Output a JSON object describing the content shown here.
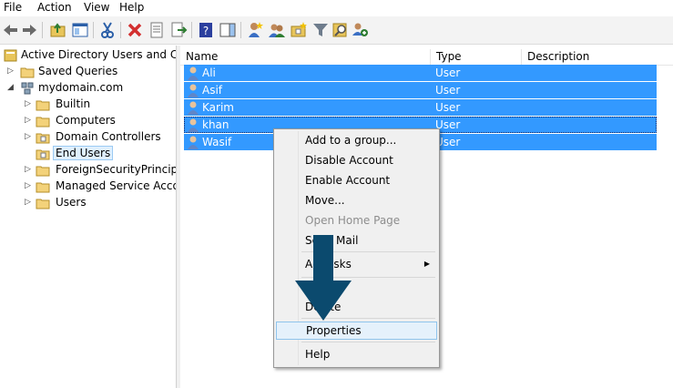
{
  "menubar": {
    "file": "File",
    "action": "Action",
    "view": "View",
    "help": "Help"
  },
  "toolbar": {
    "icons": [
      "back-arrow-icon",
      "forward-arrow-icon",
      "up-folder-icon",
      "show-hide-tree-icon",
      "cut-icon",
      "delete-icon",
      "properties-icon",
      "export-list-icon",
      "help-icon",
      "show-action-pane-icon",
      "new-user-icon",
      "new-group-icon",
      "new-ou-icon",
      "filter-icon",
      "find-icon",
      "add-to-group-icon"
    ]
  },
  "tree": {
    "root": "Active Directory Users and Com",
    "saved_queries": "Saved Queries",
    "domain": "mydomain.com",
    "children": [
      "Builtin",
      "Computers",
      "Domain Controllers",
      "End Users",
      "ForeignSecurityPrincipals",
      "Managed Service Accounts",
      "Users"
    ],
    "selected": "End Users"
  },
  "list": {
    "columns": {
      "name": "Name",
      "type": "Type",
      "description": "Description"
    },
    "rows": [
      {
        "name": "Ali",
        "type": "User"
      },
      {
        "name": "Asif",
        "type": "User"
      },
      {
        "name": "Karim",
        "type": "User"
      },
      {
        "name": "khan",
        "type": "User"
      },
      {
        "name": "Wasif",
        "type": "User"
      }
    ]
  },
  "context_menu": {
    "items": [
      {
        "label": "Add to a group...",
        "enabled": true
      },
      {
        "label": "Disable Account",
        "enabled": true
      },
      {
        "label": "Enable Account",
        "enabled": true
      },
      {
        "label": "Move...",
        "enabled": true
      },
      {
        "label": "Open Home Page",
        "enabled": false
      },
      {
        "label": "Send Mail",
        "enabled": true
      },
      {
        "label": "All Tasks",
        "enabled": true,
        "submenu": true
      },
      {
        "label": "Delete",
        "enabled": true
      },
      {
        "label": "Properties",
        "enabled": true,
        "highlighted": true
      },
      {
        "label": "Help",
        "enabled": true
      }
    ]
  },
  "colors": {
    "selection": "#3399ff",
    "annotation_arrow": "#0b4a6e"
  }
}
